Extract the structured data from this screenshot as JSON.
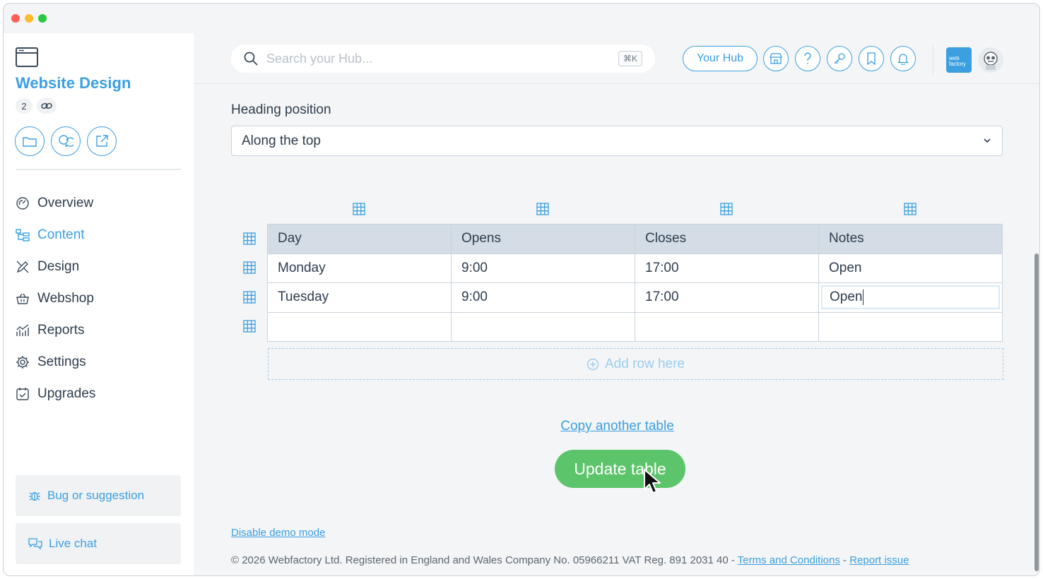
{
  "window": {
    "controls": [
      "close",
      "minimize",
      "maximize"
    ]
  },
  "sidebar": {
    "project_icon": "browser-window-icon",
    "project_title": "Website Design",
    "project_count": "2",
    "project_link_icon": "link-icon",
    "actions": [
      {
        "icon": "folder-icon"
      },
      {
        "icon": "chat-bubbles-icon"
      },
      {
        "icon": "external-link-icon"
      }
    ],
    "nav": [
      {
        "label": "Overview",
        "icon": "dashboard-icon",
        "active": false
      },
      {
        "label": "Content",
        "icon": "content-tree-icon",
        "active": true
      },
      {
        "label": "Design",
        "icon": "design-tools-icon",
        "active": false
      },
      {
        "label": "Webshop",
        "icon": "shopping-basket-icon",
        "active": false
      },
      {
        "label": "Reports",
        "icon": "reports-chart-icon",
        "active": false
      },
      {
        "label": "Settings",
        "icon": "gear-icon",
        "active": false
      },
      {
        "label": "Upgrades",
        "icon": "upgrade-calendar-icon",
        "active": false
      }
    ],
    "bug_label": "Bug or suggestion",
    "chat_label": "Live chat"
  },
  "topbar": {
    "search_placeholder": "Search your Hub...",
    "search_shortcut": "⌘K",
    "hub_button": "Your Hub",
    "icons": [
      "store-icon",
      "help-icon",
      "key-icon",
      "bookmark-icon",
      "bell-icon"
    ],
    "brand_logo_text": [
      "web",
      "factory"
    ]
  },
  "form": {
    "heading_position_label": "Heading position",
    "heading_position_value": "Along the top"
  },
  "table": {
    "headers": [
      "Day",
      "Opens",
      "Closes",
      "Notes"
    ],
    "rows": [
      [
        "Monday",
        "9:00",
        "17:00",
        "Open"
      ],
      [
        "Tuesday",
        "9:00",
        "17:00",
        "Open"
      ],
      [
        "",
        "",
        "",
        ""
      ]
    ],
    "editing_cell": "Open",
    "add_row_label": "Add row here"
  },
  "actions": {
    "copy_table_link": "Copy another table",
    "update_button": "Update table"
  },
  "footer": {
    "demo_link": "Disable demo mode",
    "copyright": "© 2026 Webfactory Ltd. Registered in England and Wales Company No. 05966211 VAT Reg. 891 2031 40 - ",
    "terms_link": "Terms and Conditions",
    "separator": " - ",
    "report_link": "Report issue"
  },
  "colors": {
    "accent": "#3b9fe0",
    "success": "#5cc46a",
    "header_bg": "#d4dde5",
    "page_bg": "#f4f5f6"
  }
}
